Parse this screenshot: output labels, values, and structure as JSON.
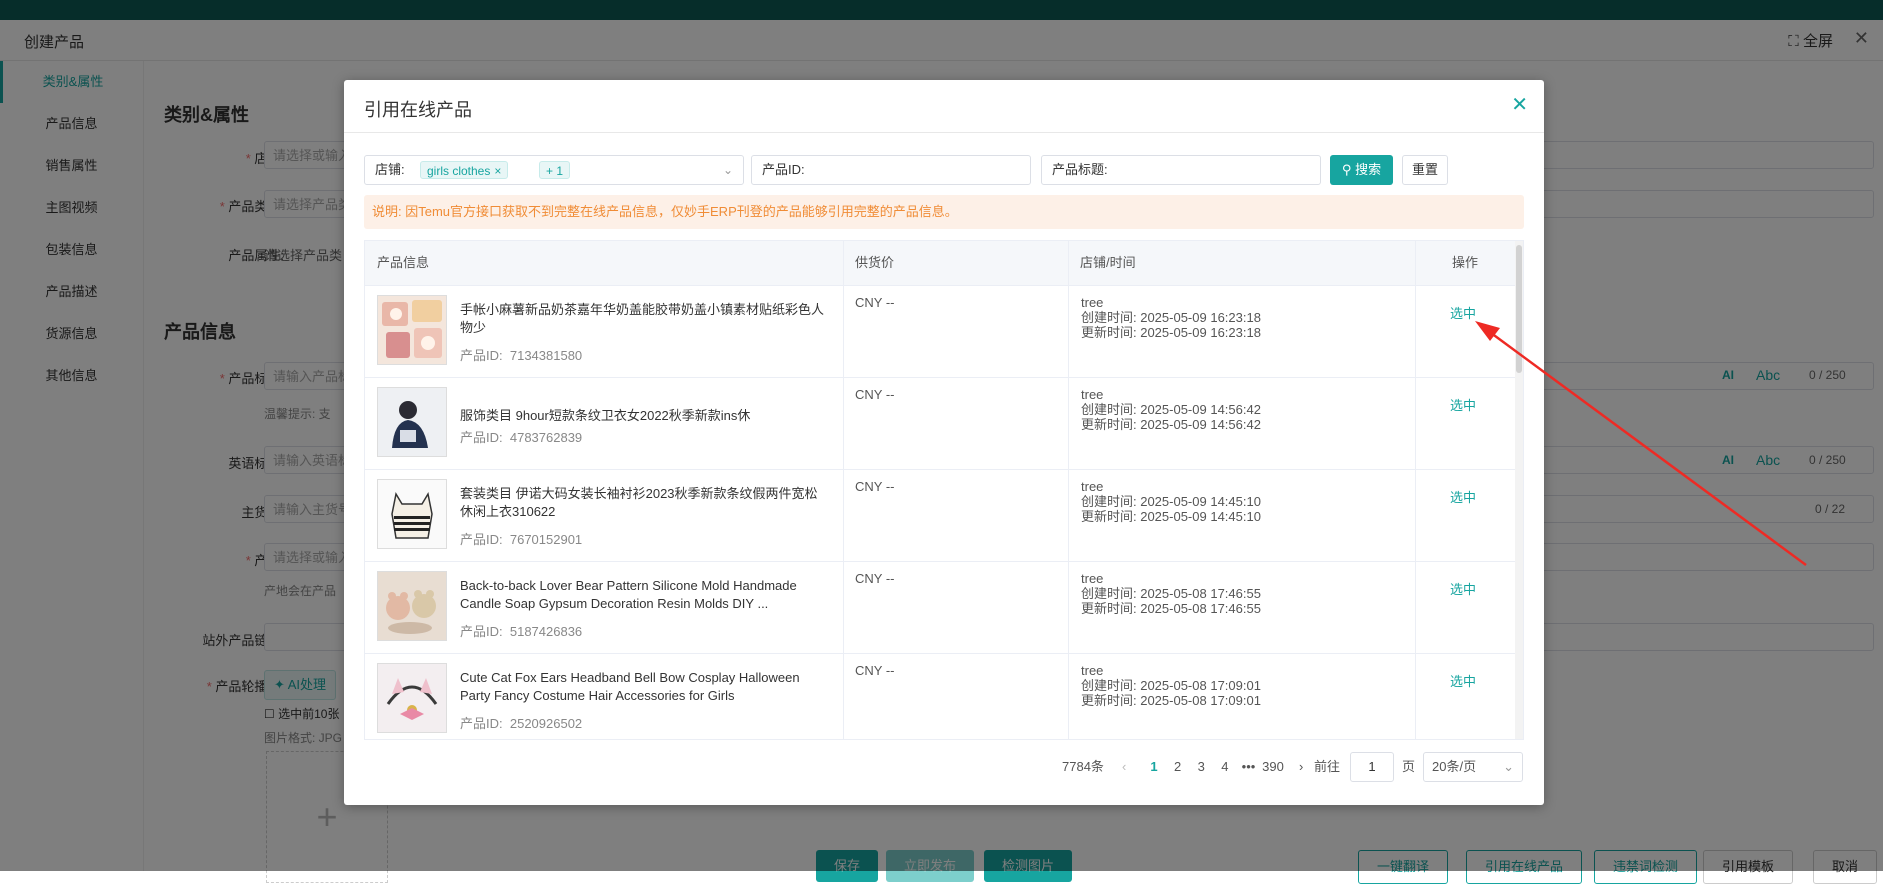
{
  "background": {
    "window_title": "创建产品",
    "fullscreen_label": "全屏",
    "sidebar": [
      {
        "label": "类别&属性"
      },
      {
        "label": "产品信息"
      },
      {
        "label": "销售属性"
      },
      {
        "label": "主图视频"
      },
      {
        "label": "包装信息"
      },
      {
        "label": "产品描述"
      },
      {
        "label": "货源信息"
      },
      {
        "label": "其他信息"
      }
    ],
    "section_category": "类别&属性",
    "section_product": "产品信息",
    "labels": {
      "store": "店铺:",
      "category": "产品类别:",
      "attributes": "产品属性:",
      "title": "产品标题:",
      "english_title": "英语标题:",
      "sku": "主货号:",
      "origin": "产地:",
      "external_link": "站外产品链接:",
      "carousel": "产品轮播图:"
    },
    "placeholders": {
      "store": "请选择或输入",
      "category": "请选择产品类",
      "title": "请输入产品标",
      "english_title": "请输入英语标",
      "sku": "请输入主货号",
      "origin": "请选择或输入"
    },
    "attributes_hint": "请选择产品类",
    "title_tip": "温馨提示: 支",
    "origin_tip": "产地会在产品",
    "ai_button": "AI处理",
    "select_first_10": "选中前10张",
    "image_format": "图片格式: JPG",
    "title_counter": "0 / 250",
    "english_counter": "0 / 250",
    "sku_counter": "0 / 22",
    "abc_label": "Abc",
    "ai_label": "AI",
    "bottom_buttons": {
      "save": "保存",
      "publish": "立即发布",
      "check_images": "检测图片",
      "translate": "一键翻译",
      "cite_online": "引用在线产品",
      "forbidden_check": "违禁词检测",
      "cite_template": "引用模板",
      "cancel": "取消"
    }
  },
  "modal": {
    "title": "引用在线产品",
    "filters": {
      "store_label": "店铺:",
      "store_tag": "girls clothes",
      "store_more": "+ 1",
      "product_id_label": "产品ID:",
      "product_title_label": "产品标题:",
      "search_button": "搜索",
      "reset_button": "重置"
    },
    "notice": "说明: 因Temu官方接口获取不到完整在线产品信息，仅妙手ERP刊登的产品能够引用完整的产品信息。",
    "columns": [
      "产品信息",
      "供货价",
      "店铺/时间",
      "操作"
    ],
    "rows": [
      {
        "name": "手帐小麻薯新品奶茶嘉年华奶盖能胶带奶盖小镇素材贴纸彩色人物少",
        "id_label": "产品ID:",
        "id": "7134381580",
        "price": "CNY --",
        "store": "tree",
        "created": "创建时间: 2025-05-09 16:23:18",
        "updated": "更新时间: 2025-05-09 16:23:18",
        "action": "选中"
      },
      {
        "name": "服饰类目 9hour短款条纹卫衣女2022秋季新款ins休",
        "id_label": "产品ID:",
        "id": "4783762839",
        "price": "CNY --",
        "store": "tree",
        "created": "创建时间: 2025-05-09 14:56:42",
        "updated": "更新时间: 2025-05-09 14:56:42",
        "action": "选中"
      },
      {
        "name": "套装类目 伊诺大码女装长袖衬衫2023秋季新款条纹假两件宽松休闲上衣310622",
        "id_label": "产品ID:",
        "id": "7670152901",
        "price": "CNY --",
        "store": "tree",
        "created": "创建时间: 2025-05-09 14:45:10",
        "updated": "更新时间: 2025-05-09 14:45:10",
        "action": "选中"
      },
      {
        "name": "Back-to-back Lover Bear Pattern Silicone Mold Handmade Candle Soap Gypsum Decoration Resin Molds DIY ...",
        "id_label": "产品ID:",
        "id": "5187426836",
        "price": "CNY --",
        "store": "tree",
        "created": "创建时间: 2025-05-08 17:46:55",
        "updated": "更新时间: 2025-05-08 17:46:55",
        "action": "选中"
      },
      {
        "name": "Cute Cat Fox Ears Headband Bell Bow Cosplay Halloween Party Fancy Costume Hair Accessories for Girls",
        "id_label": "产品ID:",
        "id": "2520926502",
        "price": "CNY --",
        "store": "tree",
        "created": "创建时间: 2025-05-08 17:09:01",
        "updated": "更新时间: 2025-05-08 17:09:01",
        "action": "选中"
      }
    ],
    "pagination": {
      "total": "7784条",
      "pages": [
        "1",
        "2",
        "3",
        "4"
      ],
      "ellipsis": "•••",
      "last_page": "390",
      "goto_label": "前往",
      "goto_value": "1",
      "page_unit": "页",
      "page_size": "20条/页"
    }
  },
  "annotation_color": "#ee2a24",
  "accent_color": "#17a5a0"
}
